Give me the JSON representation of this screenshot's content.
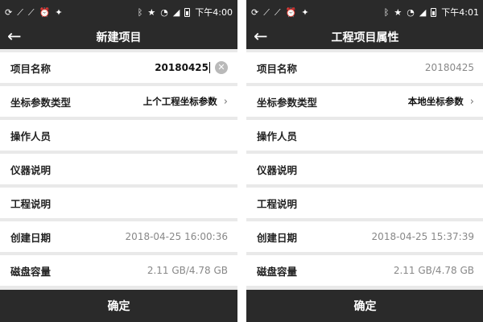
{
  "left": {
    "status": {
      "time": "下午4:00"
    },
    "title": "新建项目",
    "rows": [
      {
        "label": "项目名称",
        "value": "20180425"
      },
      {
        "label": "坐标参数类型",
        "value": "上个工程坐标参数"
      },
      {
        "label": "操作人员",
        "value": ""
      },
      {
        "label": "仪器说明",
        "value": ""
      },
      {
        "label": "工程说明",
        "value": ""
      },
      {
        "label": "创建日期",
        "value": "2018-04-25 16:00:36"
      },
      {
        "label": "磁盘容量",
        "value": "2.11 GB/4.78 GB"
      }
    ],
    "confirm": "确定"
  },
  "right": {
    "status": {
      "time": "下午4:01"
    },
    "title": "工程项目属性",
    "rows": [
      {
        "label": "项目名称",
        "value": "20180425"
      },
      {
        "label": "坐标参数类型",
        "value": "本地坐标参数"
      },
      {
        "label": "操作人员",
        "value": ""
      },
      {
        "label": "仪器说明",
        "value": ""
      },
      {
        "label": "工程说明",
        "value": ""
      },
      {
        "label": "创建日期",
        "value": "2018-04-25 15:37:39"
      },
      {
        "label": "磁盘容量",
        "value": "2.11 GB/4.78 GB"
      }
    ],
    "confirm": "确定"
  },
  "icons": {
    "status_left": [
      "sync-icon",
      "silent-icon",
      "mute-icon",
      "alarm-icon",
      "android-icon"
    ],
    "status_right": [
      "bluetooth-icon",
      "star-icon",
      "wifi-icon",
      "signal-icon",
      "battery-icon"
    ],
    "back": "back-arrow-icon",
    "clear": "clear-icon",
    "chevron": "chevron-right-icon"
  },
  "colors": {
    "bar": "#2a2a2a",
    "background": "#e9e9e9",
    "row": "#ffffff"
  }
}
